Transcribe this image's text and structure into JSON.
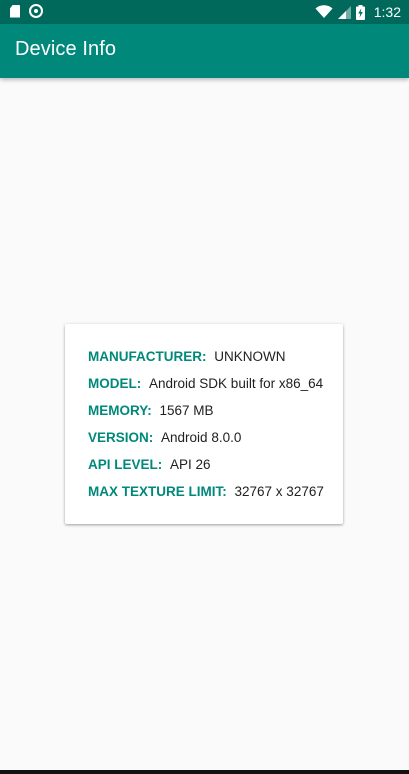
{
  "status_bar": {
    "time": "1:32",
    "icons": [
      "sd-card-icon",
      "sync-icon",
      "wifi-icon",
      "signal-icon",
      "battery-charging-icon"
    ]
  },
  "app_bar": {
    "title": "Device Info"
  },
  "device_info": {
    "rows": [
      {
        "label": "MANUFACTURER:",
        "value": "UNKNOWN"
      },
      {
        "label": "MODEL:",
        "value": "Android SDK built for x86_64"
      },
      {
        "label": "MEMORY:",
        "value": "1567 MB"
      },
      {
        "label": "VERSION:",
        "value": "Android 8.0.0"
      },
      {
        "label": "API LEVEL:",
        "value": "API 26"
      },
      {
        "label": "MAX TEXTURE LIMIT:",
        "value": "32767 x 32767"
      }
    ]
  },
  "colors": {
    "status_bar": "#00695c",
    "app_bar": "#00897b",
    "label_accent": "#00897b",
    "background": "#fafafa",
    "value_text": "#212121"
  }
}
